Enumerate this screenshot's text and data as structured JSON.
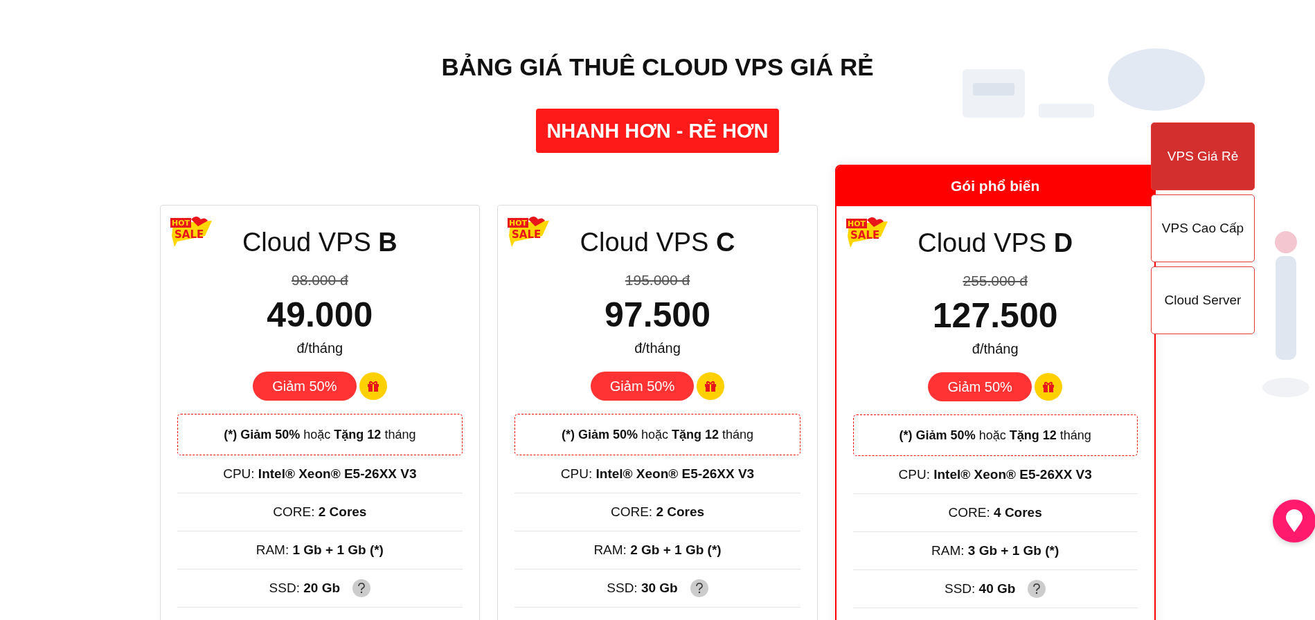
{
  "heading": "BẢNG GIÁ THUÊ CLOUD VPS GIÁ RẺ",
  "banner": "NHANH HƠN - RẺ HƠN",
  "plans": [
    {
      "featured": false,
      "hot_badge": [
        "HOT",
        "SALE"
      ],
      "name": "Cloud VPS **B**",
      "old_price": "98.000 đ",
      "price": "49.000",
      "unit": "đ/tháng",
      "discount": "Giảm 50%",
      "promo": "**(*) Giảm 50%** hoặc **Tặng 12** tháng",
      "specs": [
        {
          "text": "CPU: **Intel® Xeon® E5-26XX V3**",
          "help": false
        },
        {
          "text": "CORE: **2 Cores**",
          "help": false
        },
        {
          "text": "RAM: **1 Gb + 1 Gb (*)**",
          "help": false
        },
        {
          "text": "SSD: **20 Gb**",
          "help": true
        }
      ]
    },
    {
      "featured": false,
      "hot_badge": [
        "HOT",
        "SALE"
      ],
      "name": "Cloud VPS **C**",
      "old_price": "195.000 đ",
      "price": "97.500",
      "unit": "đ/tháng",
      "discount": "Giảm 50%",
      "promo": "**(*) Giảm 50%** hoặc **Tặng 12** tháng",
      "specs": [
        {
          "text": "CPU: **Intel® Xeon® E5-26XX V3**",
          "help": false
        },
        {
          "text": "CORE: **2 Cores**",
          "help": false
        },
        {
          "text": "RAM: **2 Gb + 1 Gb (*)**",
          "help": false
        },
        {
          "text": "SSD: **30 Gb**",
          "help": true
        }
      ]
    },
    {
      "featured": true,
      "featured_label": "Gói phổ biến",
      "hot_badge": [
        "HOT",
        "SALE"
      ],
      "name": "Cloud VPS **D**",
      "old_price": "255.000 đ",
      "price": "127.500",
      "unit": "đ/tháng",
      "discount": "Giảm 50%",
      "promo": "**(*) Giảm 50%** hoặc **Tặng 12** tháng",
      "specs": [
        {
          "text": "CPU: **Intel® Xeon® E5-26XX V3**",
          "help": false
        },
        {
          "text": "CORE: **4 Cores**",
          "help": false
        },
        {
          "text": "RAM: **3 Gb + 1 Gb (*)**",
          "help": false
        },
        {
          "text": "SSD: **40 Gb**",
          "help": true
        }
      ]
    }
  ],
  "tabs": [
    {
      "label": "VPS Giá Rẻ",
      "selected": true
    },
    {
      "label": "VPS Cao Cấp",
      "selected": false
    },
    {
      "label": "Cloud Server",
      "selected": false
    }
  ]
}
